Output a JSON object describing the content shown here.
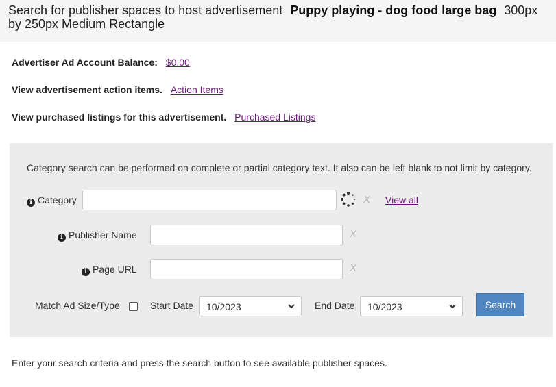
{
  "header": {
    "prefix": "Search for publisher spaces to host advertisement",
    "product_name": "Puppy playing - dog food large bag",
    "ad_size": "300px by 250px Medium Rectangle"
  },
  "account": {
    "balance_label": "Advertiser Ad Account Balance:",
    "balance_value": "$0.00"
  },
  "action_items": {
    "label": "View advertisement action items.",
    "link": "Action Items"
  },
  "purchased": {
    "label": "View purchased listings for this advertisement.",
    "link": "Purchased Listings"
  },
  "search_panel": {
    "note": "Category search can be performed on complete or partial category text. It also can be left blank to not limit by category.",
    "category": {
      "label": "Category",
      "value": "",
      "view_all": "View all",
      "clear": "X"
    },
    "publisher": {
      "label": "Publisher Name",
      "value": "",
      "clear": "X"
    },
    "page_url": {
      "label": "Page URL",
      "value": "",
      "clear": "X"
    },
    "match_label": "Match Ad Size/Type",
    "match_checked": false,
    "start_date": {
      "label": "Start Date",
      "value": "10/2023"
    },
    "end_date": {
      "label": "End Date",
      "value": "10/2023"
    },
    "search_button": "Search",
    "info_icon": "info-circle-icon"
  },
  "footer": {
    "text": "Enter your search criteria and press the search button to see available publisher spaces."
  },
  "colors": {
    "link": "#6a1b7a",
    "button": "#4f86c0",
    "panel_bg": "#ececec",
    "header_bg": "#f5f5f5"
  }
}
